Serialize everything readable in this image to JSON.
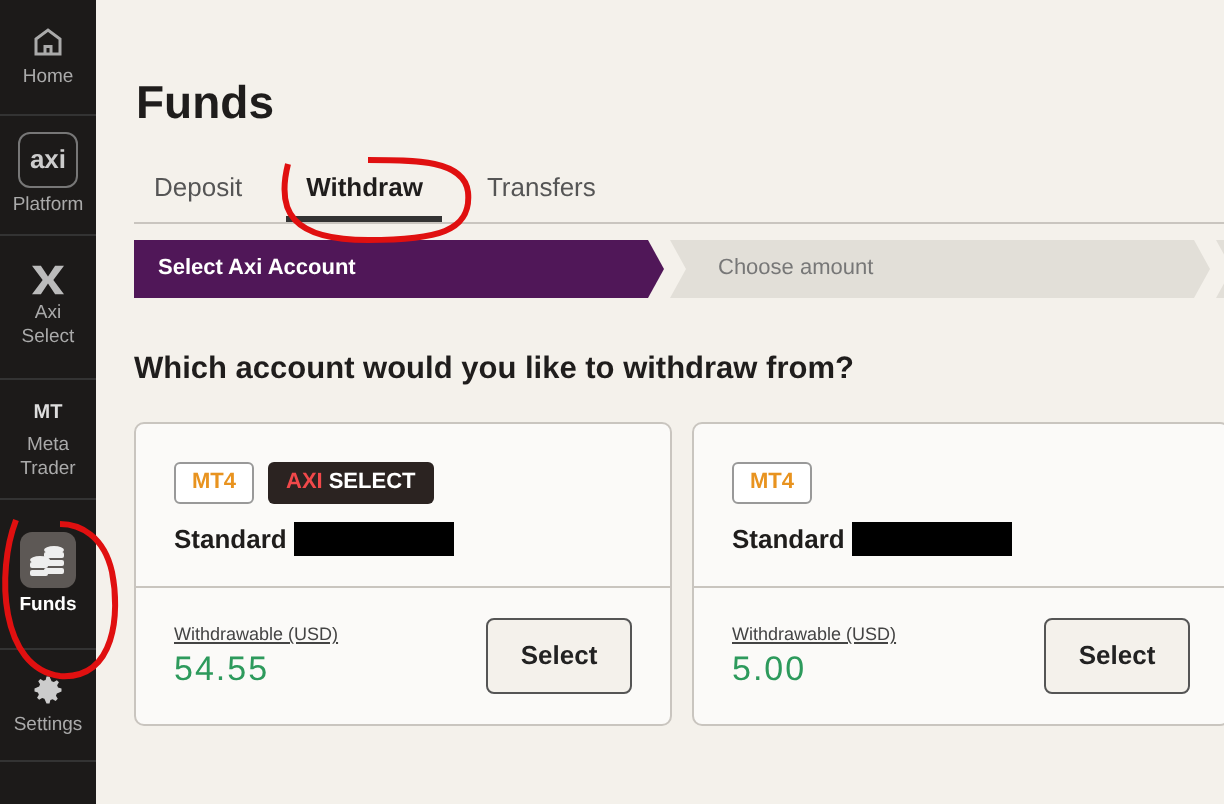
{
  "sidebar": {
    "items": [
      {
        "kind": "home",
        "label": "Home",
        "selected": false
      },
      {
        "kind": "axi",
        "glyph": "axi",
        "label": "Platform",
        "selected": false
      },
      {
        "kind": "x",
        "label": "Axi Select",
        "selected": false
      },
      {
        "kind": "mt",
        "glyph": "MT",
        "label": "Meta Trader",
        "selected": false
      },
      {
        "kind": "coins",
        "label": "Funds",
        "selected": true
      },
      {
        "kind": "gear",
        "label": "Settings",
        "selected": false
      }
    ]
  },
  "page": {
    "title": "Funds"
  },
  "tabs": [
    {
      "label": "Deposit",
      "selected": false
    },
    {
      "label": "Withdraw",
      "selected": true
    },
    {
      "label": "Transfers",
      "selected": false
    }
  ],
  "steps": [
    {
      "label": "Select Axi Account",
      "selected": true
    },
    {
      "label": "Choose amount",
      "selected": false
    },
    {
      "selected": false
    }
  ],
  "question": "Which account would you like to withdraw from?",
  "accounts": [
    {
      "badges": [
        {
          "kind": "platform",
          "text": "MT4"
        },
        {
          "kind": "axi-select",
          "prefix": "AXI",
          "text": "SELECT"
        }
      ],
      "type": "Standard",
      "redacted": true,
      "balance_label": "Withdrawable (USD)",
      "balance": "54.55",
      "button": "Select"
    },
    {
      "badges": [
        {
          "kind": "platform",
          "text": "MT4"
        }
      ],
      "type": "Standard",
      "redacted": true,
      "balance_label": "Withdrawable (USD)",
      "balance": "5.00",
      "button": "Select"
    }
  ],
  "annotations": [
    {
      "kind": "circle"
    },
    {
      "kind": "circle"
    }
  ]
}
